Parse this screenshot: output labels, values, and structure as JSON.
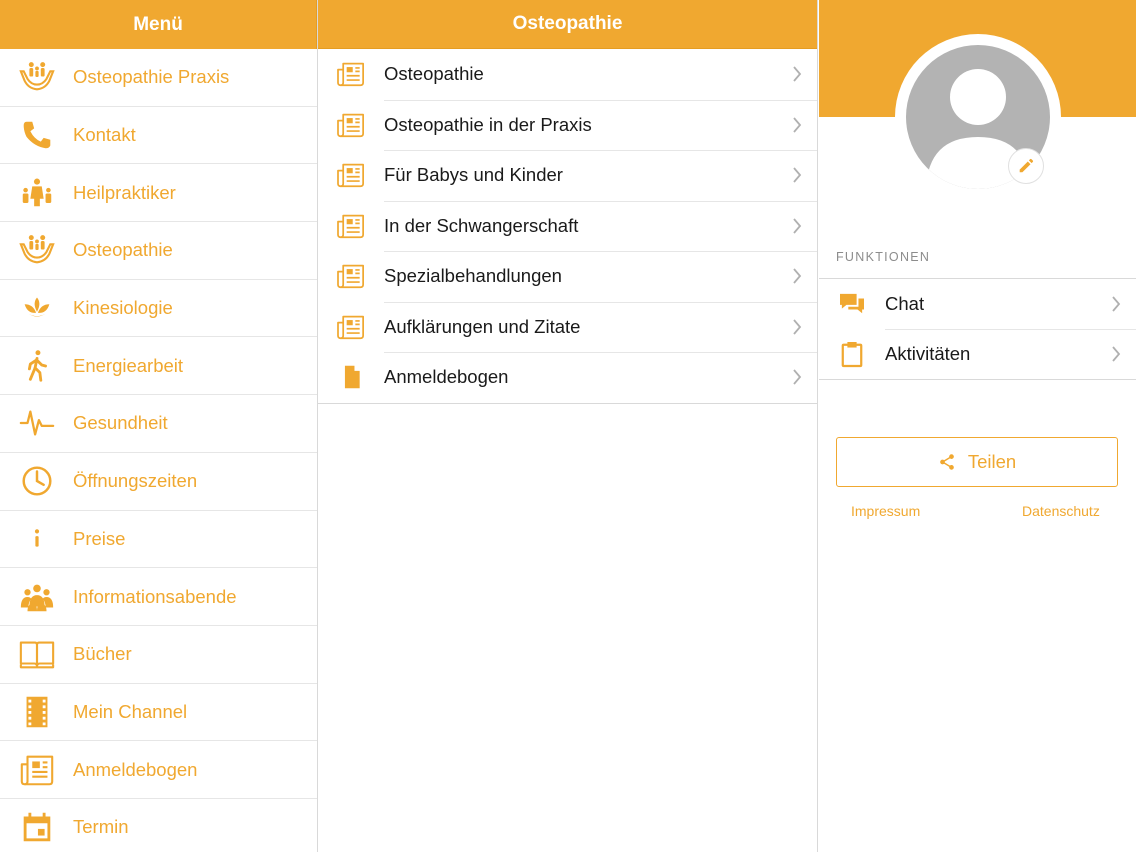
{
  "colors": {
    "accent": "#f0a830",
    "accent_dark": "#e59d22",
    "avatar_gray": "#b3b3b3"
  },
  "menu": {
    "title": "Menü",
    "items": [
      {
        "label": "Osteopathie Praxis",
        "icon": "hands-family-icon"
      },
      {
        "label": "Kontakt",
        "icon": "phone-icon"
      },
      {
        "label": "Heilpraktiker",
        "icon": "family-icon"
      },
      {
        "label": "Osteopathie",
        "icon": "hands-family-icon"
      },
      {
        "label": "Kinesiologie",
        "icon": "lotus-icon"
      },
      {
        "label": "Energiearbeit",
        "icon": "walking-person-icon"
      },
      {
        "label": "Gesundheit",
        "icon": "heartbeat-icon"
      },
      {
        "label": "Öffnungszeiten",
        "icon": "clock-icon"
      },
      {
        "label": "Preise",
        "icon": "info-icon"
      },
      {
        "label": "Informationsabende",
        "icon": "group-icon"
      },
      {
        "label": "Bücher",
        "icon": "open-book-icon"
      },
      {
        "label": "Mein Channel",
        "icon": "film-strip-icon"
      },
      {
        "label": "Anmeldebogen",
        "icon": "newspaper-icon"
      },
      {
        "label": "Termin",
        "icon": "calendar-icon"
      }
    ]
  },
  "content": {
    "title": "Osteopathie",
    "items": [
      {
        "label": "Osteopathie",
        "icon": "newspaper-icon"
      },
      {
        "label": "Osteopathie in der Praxis",
        "icon": "newspaper-icon"
      },
      {
        "label": "Für Babys und Kinder",
        "icon": "newspaper-icon"
      },
      {
        "label": "In der Schwangerschaft",
        "icon": "newspaper-icon"
      },
      {
        "label": "Spezialbehandlungen",
        "icon": "newspaper-icon"
      },
      {
        "label": "Aufklärungen und Zitate",
        "icon": "newspaper-icon"
      },
      {
        "label": "Anmeldebogen",
        "icon": "document-icon"
      }
    ]
  },
  "profile": {
    "section_title": "FUNKTIONEN",
    "functions": [
      {
        "label": "Chat",
        "icon": "chat-bubbles-icon"
      },
      {
        "label": "Aktivitäten",
        "icon": "clipboard-icon"
      }
    ],
    "share_label": "Teilen",
    "impressum_label": "Impressum",
    "datenschutz_label": "Datenschutz"
  }
}
